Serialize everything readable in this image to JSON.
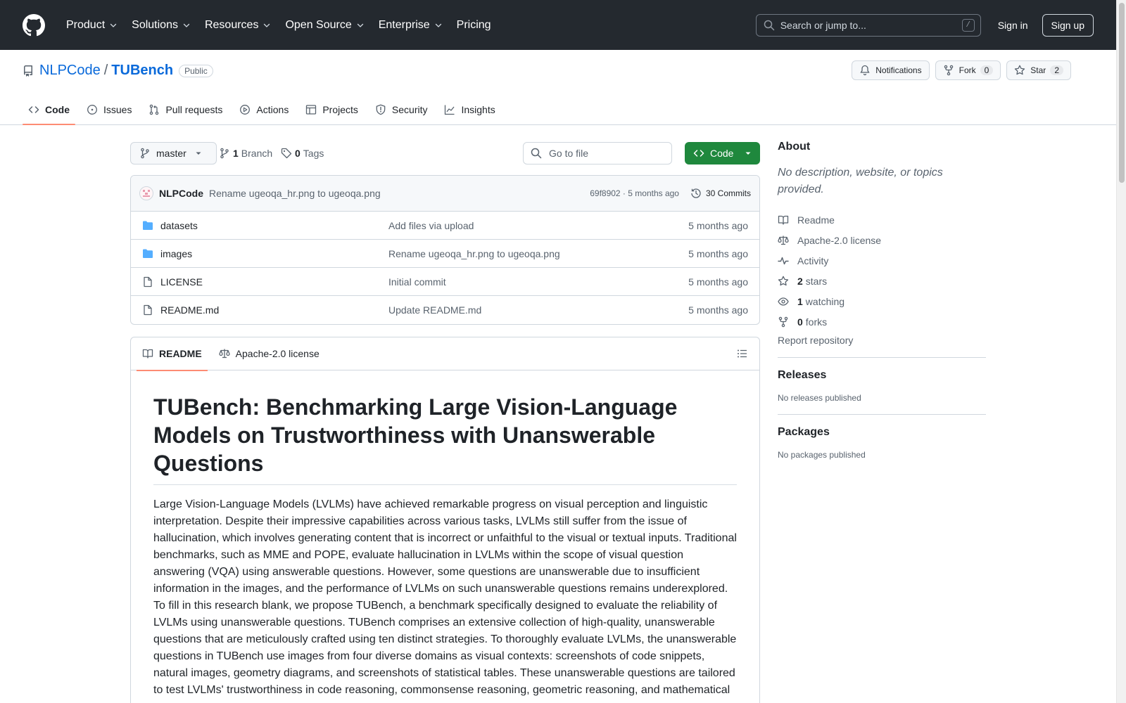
{
  "header": {
    "nav": [
      {
        "label": "Product",
        "has_menu": true
      },
      {
        "label": "Solutions",
        "has_menu": true
      },
      {
        "label": "Resources",
        "has_menu": true
      },
      {
        "label": "Open Source",
        "has_menu": true
      },
      {
        "label": "Enterprise",
        "has_menu": true
      },
      {
        "label": "Pricing",
        "has_menu": false
      }
    ],
    "search_placeholder": "Search or jump to...",
    "search_shortcut": "/",
    "sign_in": "Sign in",
    "sign_up": "Sign up"
  },
  "repo": {
    "owner": "NLPCode",
    "separator": "/",
    "name": "TUBench",
    "visibility": "Public",
    "notifications_label": "Notifications",
    "fork_label": "Fork",
    "fork_count": "0",
    "star_label": "Star",
    "star_count": "2"
  },
  "tabs": [
    {
      "label": "Code",
      "icon": "code-icon",
      "active": true
    },
    {
      "label": "Issues",
      "icon": "issue-icon",
      "active": false
    },
    {
      "label": "Pull requests",
      "icon": "pull-request-icon",
      "active": false
    },
    {
      "label": "Actions",
      "icon": "play-icon",
      "active": false
    },
    {
      "label": "Projects",
      "icon": "table-icon",
      "active": false
    },
    {
      "label": "Security",
      "icon": "shield-icon",
      "active": false
    },
    {
      "label": "Insights",
      "icon": "graph-icon",
      "active": false
    }
  ],
  "toolbar": {
    "branch": "master",
    "branch_count": "1",
    "branch_label": "Branch",
    "tag_count": "0",
    "tag_label": "Tags",
    "goto_placeholder": "Go to file",
    "code_button": "Code"
  },
  "latest_commit": {
    "author": "NLPCode",
    "message": "Rename ugeoqa_hr.png to ugeoqa.png",
    "meta": "69f8902 · 5 months ago",
    "commits_label": "30 Commits"
  },
  "files": [
    {
      "name": "datasets",
      "type": "dir",
      "commit": "Add files via upload",
      "age": "5 months ago"
    },
    {
      "name": "images",
      "type": "dir",
      "commit": "Rename ugeoqa_hr.png to ugeoqa.png",
      "age": "5 months ago"
    },
    {
      "name": "LICENSE",
      "type": "file",
      "commit": "Initial commit",
      "age": "5 months ago"
    },
    {
      "name": "README.md",
      "type": "file",
      "commit": "Update README.md",
      "age": "5 months ago"
    }
  ],
  "readme": {
    "tab_readme": "README",
    "tab_license": "Apache-2.0 license",
    "title": "TUBench: Benchmarking Large Vision-Language Models on Trustworthiness with Unanswerable Questions",
    "paragraph": "Large Vision-Language Models (LVLMs) have achieved remarkable progress on visual perception and linguistic interpretation. Despite their impressive capabilities across various tasks, LVLMs still suffer from the issue of hallucination, which involves generating content that is incorrect or unfaithful to the visual or textual inputs. Traditional benchmarks, such as MME and POPE, evaluate hallucination in LVLMs within the scope of visual question answering (VQA) using answerable questions. However, some questions are unanswerable due to insufficient information in the images, and the performance of LVLMs on such unanswerable questions remains underexplored. To fill in this research blank, we propose TUBench, a benchmark specifically designed to evaluate the reliability of LVLMs using unanswerable questions. TUBench comprises an extensive collection of high-quality, unanswerable questions that are meticulously crafted using ten distinct strategies. To thoroughly evaluate LVLMs, the unanswerable questions in TUBench use images from four diverse domains as visual contexts: screenshots of code snippets, natural images, geometry diagrams, and screenshots of statistical tables. These unanswerable questions are tailored to test LVLMs' trustworthiness in code reasoning, commonsense reasoning, geometric reasoning, and mathematical"
  },
  "sidebar": {
    "about_title": "About",
    "about_desc": "No description, website, or topics provided.",
    "links": [
      {
        "icon": "book-icon",
        "count": "",
        "label": "Readme"
      },
      {
        "icon": "law-icon",
        "count": "",
        "label": "Apache-2.0 license"
      },
      {
        "icon": "pulse-icon",
        "count": "",
        "label": "Activity"
      },
      {
        "icon": "star-icon",
        "count": "2",
        "label": "stars"
      },
      {
        "icon": "eye-icon",
        "count": "1",
        "label": "watching"
      },
      {
        "icon": "fork-icon",
        "count": "0",
        "label": "forks"
      }
    ],
    "report": "Report repository",
    "releases_title": "Releases",
    "releases_empty": "No releases published",
    "packages_title": "Packages",
    "packages_empty": "No packages published"
  },
  "colors": {
    "header_bg": "#24292f",
    "link": "#0969da",
    "green_button": "#1f883d",
    "active_tab_underline": "#fd8c73",
    "folder": "#54aeff"
  }
}
